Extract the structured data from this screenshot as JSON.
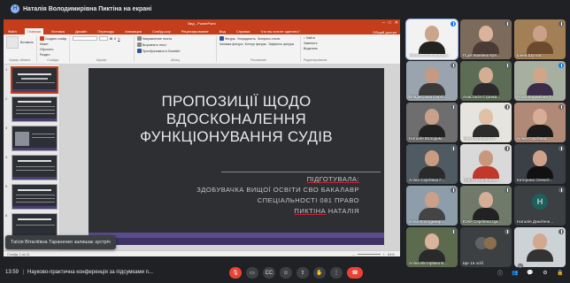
{
  "banner": {
    "presenter_text": "Наталія Володимирівна Пиктіна на екрані"
  },
  "ppt": {
    "window_title": "Вид - PowerPoint",
    "tabs": [
      "Файл",
      "Главная",
      "Вставка",
      "Дизайн",
      "Переходы",
      "Анимация",
      "Слайд-шоу",
      "Рецензирование",
      "Вид",
      "Справка"
    ],
    "active_tab": "Главная",
    "tell_me": "Что вы хотите сделать?",
    "share": "Общий доступ",
    "ribbon": {
      "clipboard": {
        "paste": "Вставить",
        "label": "Буфер обмена"
      },
      "slides": {
        "new_slide": "Создать слайд",
        "layout": "Макет",
        "reset": "Сбросить",
        "section": "Раздел",
        "label": "Слайды"
      },
      "font": {
        "label": "Шрифт"
      },
      "paragraph": {
        "direction": "Направление текста",
        "align": "Выровнять текст",
        "smartart": "Преобразовать в SmartArt",
        "label": "Абзац"
      },
      "drawing": {
        "shapes": "Фигуры",
        "arrange": "Упорядочить",
        "quick_styles": "Экспресс-стили",
        "fill": "Заливка фигуры",
        "outline": "Контур фигуры",
        "effects": "Эффекты фигуры",
        "label": "Рисование"
      },
      "editing": {
        "find": "Найти",
        "replace": "Заменить",
        "select": "Выделить",
        "label": "Редактирование"
      }
    },
    "slide": {
      "title_lines": [
        "ПРОПОЗИЦІЇ ЩОДО",
        "ВДОСКОНАЛЕННЯ",
        "ФУНКЦІОНУВАННЯ СУДІВ"
      ],
      "info_line1": "ПІДГОТУВАЛА:",
      "info_line2": "ЗДОБУВАЧКА ВИЩОЇ ОСВІТИ СВО БАКАЛАВР",
      "info_line3": "СПЕЦІАЛЬНОСТІ 081 ПРАВО",
      "info_line4_a": "ПИКТІНА",
      "info_line4_b": " НАТАЛІЯ"
    },
    "thumb_numbers": [
      "1",
      "2",
      "3",
      "4",
      "5",
      "6"
    ],
    "status_left": "Слайд 1 из 11",
    "zoom": "64%"
  },
  "toast": {
    "text": "Таїсія Віталіївна Тараненко залишає зустріч"
  },
  "participants": [
    {
      "name": "Наталія Володимирі...",
      "type": "video",
      "skin": "#c9a58c",
      "bg": "#f2f2f2",
      "shirt": "#222",
      "active": true,
      "mic": true
    },
    {
      "name": "Підія Іванівна Кув...",
      "type": "video",
      "skin": "#d9b39b",
      "bg": "#7c6a5a",
      "shirt": "#4a3b35",
      "mic": false
    },
    {
      "name": "Ірина Шулла",
      "type": "video",
      "skin": "#caa089",
      "bg": "#a27f55",
      "shirt": "#6b4a2e",
      "mic": false
    },
    {
      "name": "Владислава Сергі...",
      "type": "video",
      "skin": "#c49a82",
      "bg": "#9aa4ae",
      "shirt": "#3a3a3a",
      "mic": false
    },
    {
      "name": "Анастасія Стрижа...",
      "type": "video",
      "skin": "#d4ad93",
      "bg": "#5d6c55",
      "shirt": "#2a2a2a",
      "mic": false
    },
    {
      "name": "Алла Вадимівна Т...",
      "type": "video",
      "skin": "#d0a58a",
      "bg": "#a7b0a0",
      "shirt": "#3b2d4a",
      "mic": true
    },
    {
      "name": "Наталія Володим...",
      "type": "video",
      "skin": "#caa089",
      "bg": "#6e6e6e",
      "shirt": "#222",
      "mic": false
    },
    {
      "name": "Інна Сергіївна М...",
      "type": "video",
      "skin": "#e0c0a6",
      "bg": "#e6e4de",
      "shirt": "#2c2c2c",
      "mic": false
    },
    {
      "name": "Аліна Сергіївна",
      "type": "video",
      "skin": "#d6ae96",
      "bg": "#b08a77",
      "shirt": "#1a1a1a",
      "mic": false
    },
    {
      "name": "Аліна Сергіївна Г...",
      "type": "video",
      "skin": "#c99b7f",
      "bg": "#4f5a63",
      "shirt": "#2a2a2a",
      "mic": false
    },
    {
      "name": "Павло Сергійович ...",
      "type": "video",
      "skin": "#c8987c",
      "bg": "#d9d9d9",
      "shirt": "#c0392b",
      "mic": false
    },
    {
      "name": "Катерина Олексії...",
      "type": "video",
      "skin": "#cfa18a",
      "bg": "#3b4047",
      "shirt": "#111",
      "mic": false
    },
    {
      "name": "Алла Володимир...",
      "type": "video",
      "skin": "#caa089",
      "bg": "#8d9eaa",
      "shirt": "#444",
      "mic": false
    },
    {
      "name": "Юлія Сергіївна Ци...",
      "type": "video",
      "skin": "#d6ae96",
      "bg": "#6f7a6a",
      "shirt": "#222",
      "mic": false
    },
    {
      "name": "Наталія Доміґене...",
      "type": "initial",
      "initial": "Н",
      "color": "#1e5f5c",
      "mic": false
    },
    {
      "name": "Аліна Вікторівна Б...",
      "type": "video",
      "skin": "#d9b39b",
      "bg": "#5c6b4d",
      "shirt": "#2a2a2a",
      "mic": false
    },
    {
      "name": "Ще 15 осіб",
      "type": "more",
      "mic": false
    },
    {
      "name": "",
      "type": "video",
      "skin": "#d2a88e",
      "bg": "#cdd2d6",
      "shirt": "#333",
      "mic": false
    }
  ],
  "bottom": {
    "time": "13:59",
    "separator": "|",
    "meeting_title": "Науково-практична конференція за підсумками п...",
    "people_count": "37"
  },
  "colors": {
    "ppt_accent": "#c43e1c",
    "meet_bg": "#202124",
    "leave_red": "#ea4335"
  }
}
